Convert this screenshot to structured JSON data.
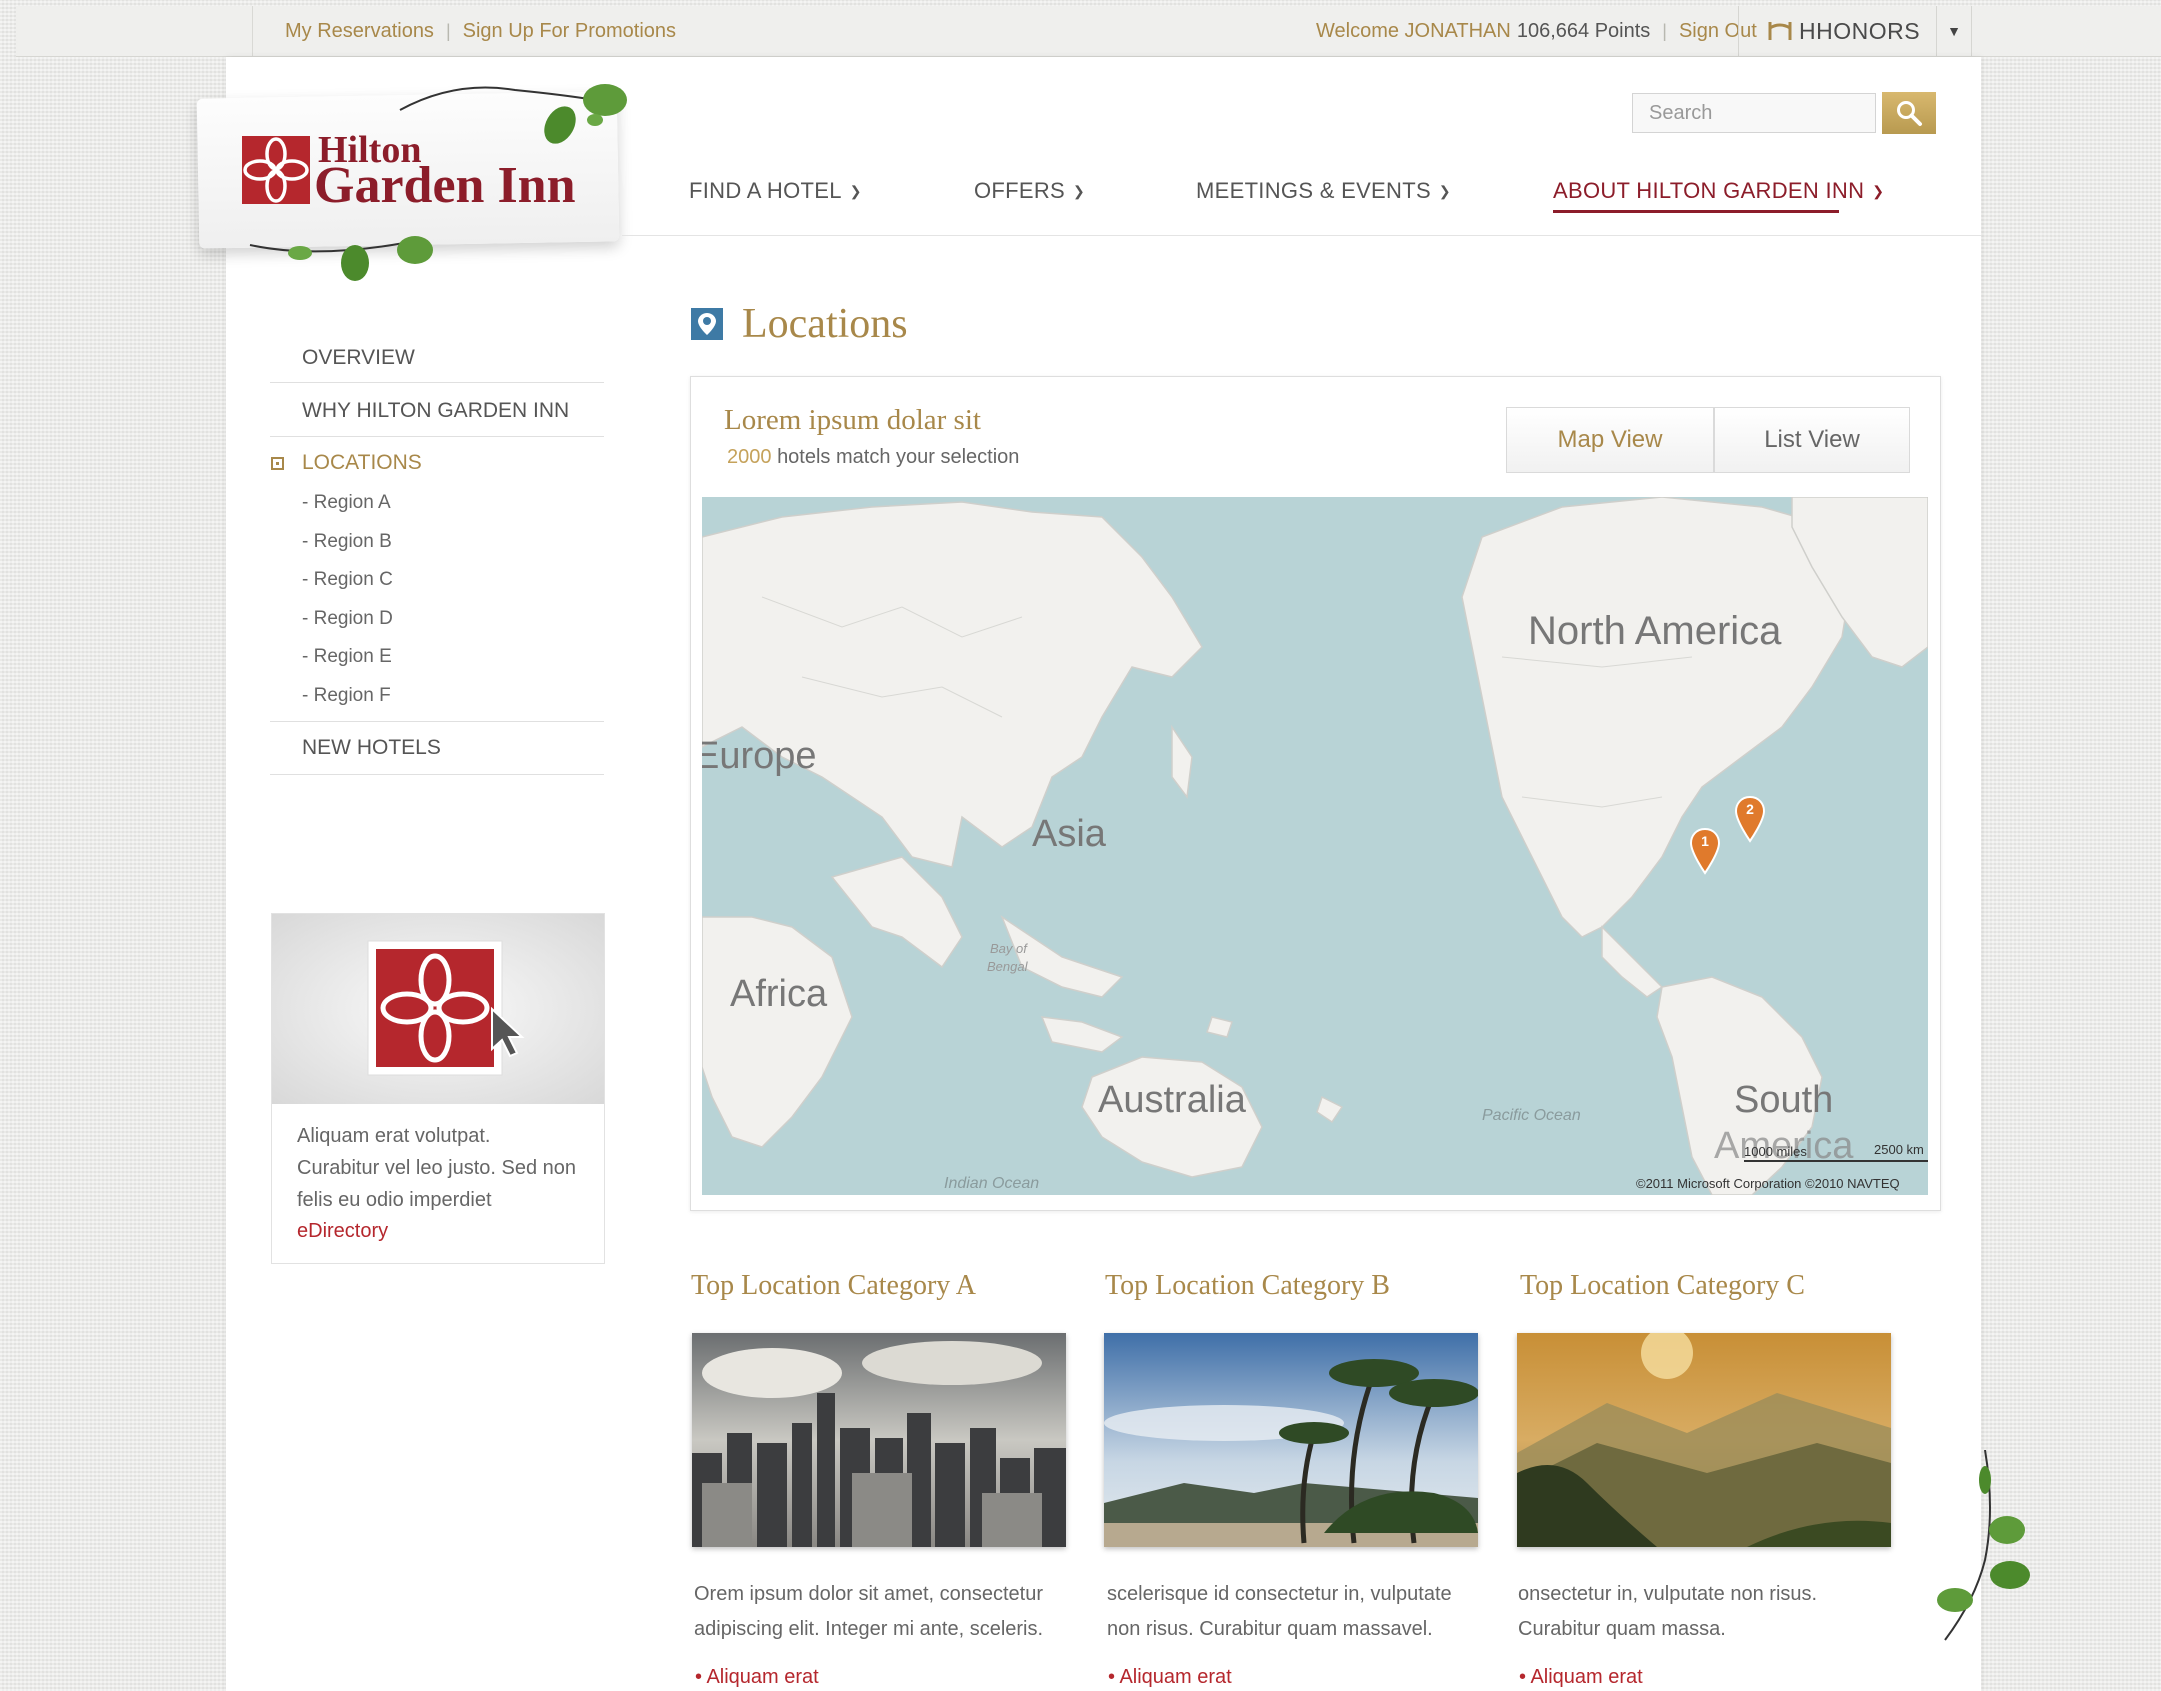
{
  "topbar": {
    "my_reservations": "My Reservations",
    "sign_up": "Sign Up For Promotions",
    "welcome": "Welcome JONATHAN",
    "points": "106,664 Points",
    "sign_out": "Sign Out",
    "hhonors": "HHONORS"
  },
  "logo": {
    "line1": "Hilton",
    "line2": "Garden Inn"
  },
  "search": {
    "placeholder": "Search"
  },
  "nav": [
    "FIND A HOTEL",
    "OFFERS",
    "MEETINGS & EVENTS",
    "ABOUT HILTON GARDEN INN"
  ],
  "sidebar": {
    "overview": "OVERVIEW",
    "why": "WHY HILTON GARDEN INN",
    "locations": "LOCATIONS",
    "regions": [
      "- Region A",
      "- Region B",
      "- Region C",
      "- Region D",
      "- Region E",
      "- Region F"
    ],
    "new_hotels": "NEW HOTELS"
  },
  "promo": {
    "text": "Aliquam erat volutpat. Curabitur vel leo justo. Sed non felis eu odio imperdiet",
    "link": "eDirectory"
  },
  "main": {
    "title": "Locations",
    "panel_title": "Lorem ipsum dolar sit",
    "hotel_count": "2000",
    "hotel_suffix": "hotels match your selection",
    "map_view": "Map View",
    "list_view": "List View"
  },
  "map": {
    "labels": {
      "north_america": "North America",
      "europe": "Europe",
      "asia": "Asia",
      "africa": "Africa",
      "australia": "Australia",
      "south_america_1": "South",
      "south_america_2": "America",
      "pacific": "Pacific Ocean",
      "indian": "Indian Ocean",
      "bay_1": "Bay of",
      "bay_2": "Bengal",
      "scale_miles": "1000 miles",
      "scale_km": "2500 km",
      "copyright": "©2011 Microsoft Corporation  ©2010 NAVTEQ"
    },
    "markers": [
      "1",
      "2"
    ]
  },
  "categories": [
    {
      "title": "Top Location Category A",
      "text": "Orem ipsum dolor sit amet, consectetur adipiscing elit. Integer mi ante, sceleris.",
      "link": "• Aliquam erat"
    },
    {
      "title": "Top Location Category B",
      "text": "scelerisque id consectetur in, vulputate non risus. Curabitur quam massavel.",
      "link": "• Aliquam erat"
    },
    {
      "title": "Top Location Category C",
      "text": "onsectetur in, vulputate non risus. Curabitur quam massa.",
      "link": "• Aliquam erat"
    }
  ],
  "colors": {
    "gold": "#a8884a",
    "brand_red": "#8c1d2a",
    "link_red": "#b5272d",
    "map_water": "#b8d3d6",
    "marker": "#e07a2c"
  }
}
